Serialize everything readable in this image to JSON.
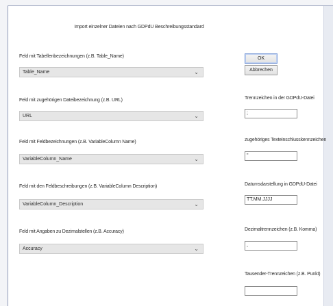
{
  "dialog": {
    "title": "Import einzelner Dateien nach GDPdU Beschreibungsstandard"
  },
  "fields": [
    {
      "label": "Feld mit Tabellenbezeichnungen (z.B. Table_Name)",
      "value": "Table_Name"
    },
    {
      "label": "Feld mit zugehörigen Dateibezeichnung (z.B. URL)",
      "value": "URL"
    },
    {
      "label": "Feld mit Feldbezeichnungen (z.B. VariableColumn Name)",
      "value": "VariableColumn_Name"
    },
    {
      "label": "Feld mit den Feldbeschreibungen (z.B. VariableColumn Description)",
      "value": "VariableColumn_Description"
    },
    {
      "label": "Feld mit Angaben zu Dezimalstellen (z.B. Accuracy)",
      "value": "Accuracy"
    }
  ],
  "buttons": {
    "ok": "OK",
    "cancel": "Abbrechen"
  },
  "settings": [
    {
      "label": "Trennzeichen in der GDPdU-Datei",
      "value": ";"
    },
    {
      "label": "zugehöriges Texteinschlusskennzeichen",
      "value": "\""
    },
    {
      "label": "Datumsdarstellung in GDPdU-Datei",
      "value": "TT.MM.JJJJ"
    },
    {
      "label": "Dezimaltrennzeichen (z.B. Komma)",
      "value": ","
    },
    {
      "label": "Tausender-Trennzeichen (z.B. Punkt)",
      "value": ""
    }
  ],
  "icons": {
    "dropdown": "chevron-down-icon"
  }
}
